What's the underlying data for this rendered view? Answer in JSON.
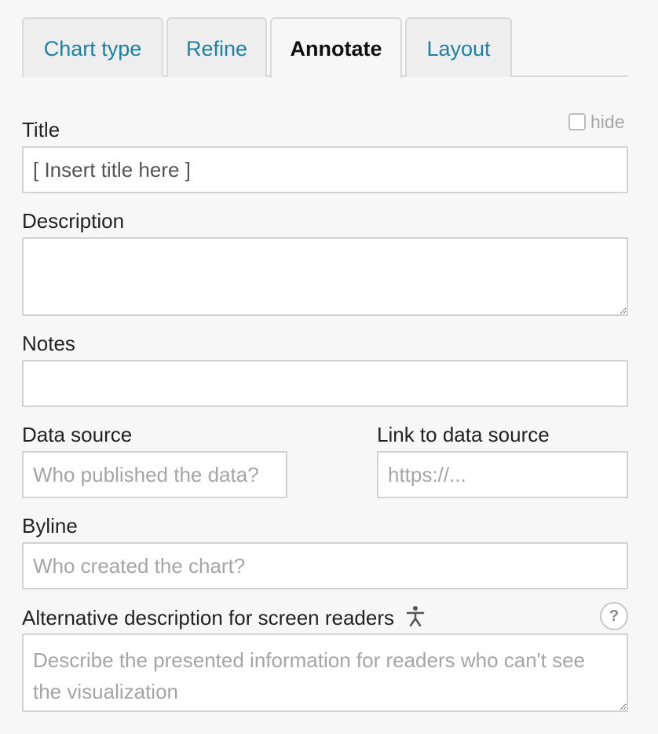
{
  "tabs": [
    {
      "label": "Chart type",
      "active": false
    },
    {
      "label": "Refine",
      "active": false
    },
    {
      "label": "Annotate",
      "active": true
    },
    {
      "label": "Layout",
      "active": false
    }
  ],
  "title_field": {
    "label": "Title",
    "value": "[ Insert title here ]",
    "hide_label": "hide",
    "hide_checked": false
  },
  "description_field": {
    "label": "Description",
    "value": ""
  },
  "notes_field": {
    "label": "Notes",
    "value": ""
  },
  "data_source_field": {
    "label": "Data source",
    "placeholder": "Who published the data?"
  },
  "link_field": {
    "label": "Link to data source",
    "placeholder": "https://..."
  },
  "byline_field": {
    "label": "Byline",
    "placeholder": "Who created the chart?"
  },
  "alt_field": {
    "label": "Alternative description for screen readers",
    "placeholder": "Describe the presented information for readers who can't see the visualization",
    "icon": "accessibility-icon",
    "help_symbol": "?"
  },
  "colors": {
    "tab_link": "#1d81a2",
    "border": "#d3d3d3",
    "background": "#f7f7f7"
  }
}
